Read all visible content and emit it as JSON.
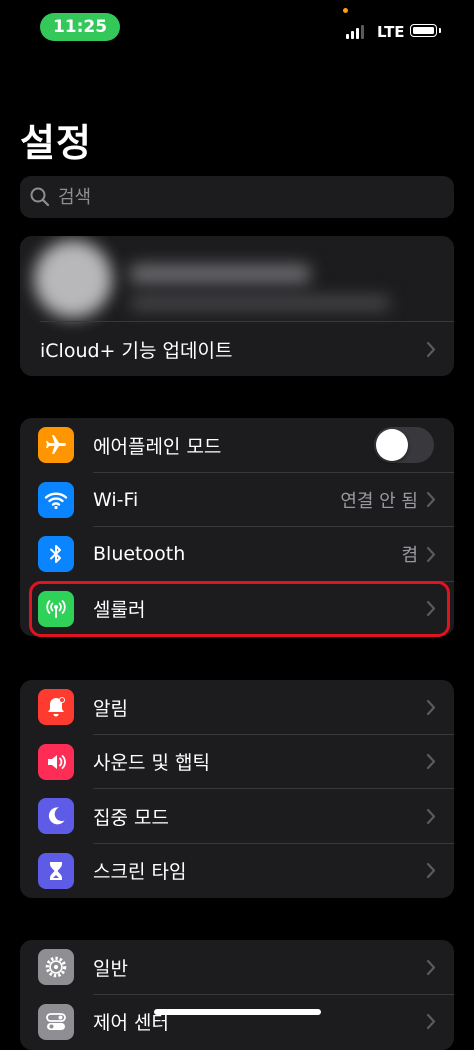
{
  "status_bar": {
    "time": "11:25",
    "network": "LTE",
    "signal_bars": 3
  },
  "page": {
    "title": "설정"
  },
  "search": {
    "placeholder": "검색"
  },
  "profile": {
    "icloud_label": "iCloud+ 기능 업데이트"
  },
  "group1": {
    "airplane": {
      "label": "에어플레인 모드",
      "toggle_on": false
    },
    "wifi": {
      "label": "Wi-Fi",
      "value": "연결 안 됨"
    },
    "bluetooth": {
      "label": "Bluetooth",
      "value": "켬"
    },
    "cellular": {
      "label": "셀룰러"
    }
  },
  "group2": {
    "notifications": {
      "label": "알림"
    },
    "sounds": {
      "label": "사운드 및 햅틱"
    },
    "focus": {
      "label": "집중 모드"
    },
    "screen_time": {
      "label": "스크린 타임"
    }
  },
  "group3": {
    "general": {
      "label": "일반"
    },
    "control_center": {
      "label": "제어 센터"
    }
  },
  "colors": {
    "airplane": "#ff9500",
    "wifi": "#0a84ff",
    "bluetooth": "#0a84ff",
    "cellular": "#30d158",
    "notifications": "#ff3b30",
    "sounds": "#ff2d55",
    "focus": "#5e5ce6",
    "screen_time": "#5e5ce6",
    "general": "#8e8e93",
    "highlight": "#e0141e"
  }
}
